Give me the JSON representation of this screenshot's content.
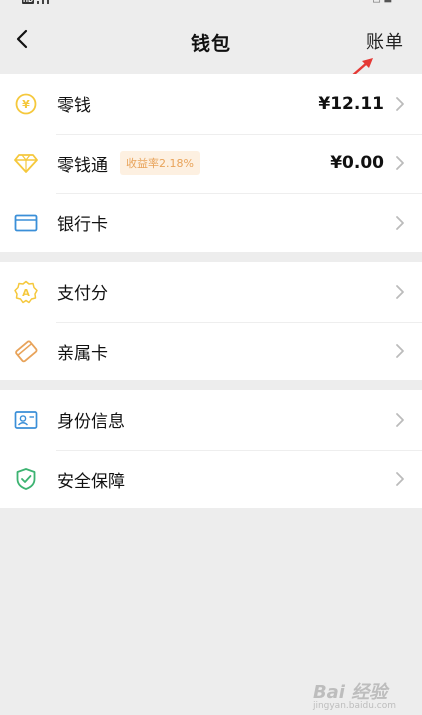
{
  "header": {
    "title": "钱包",
    "bill_label": "账单"
  },
  "groups": [
    {
      "items": [
        {
          "label": "零钱",
          "value": "¥12.11"
        },
        {
          "label": "零钱通",
          "badge": "收益率2.18%",
          "value": "¥0.00"
        },
        {
          "label": "银行卡"
        }
      ]
    },
    {
      "items": [
        {
          "label": "支付分"
        },
        {
          "label": "亲属卡"
        }
      ]
    },
    {
      "items": [
        {
          "label": "身份信息"
        },
        {
          "label": "安全保障"
        }
      ]
    }
  ],
  "icons": {
    "coin": "yuan-coin-icon",
    "diamond": "diamond-icon",
    "bank_card": "bank-card-icon",
    "score": "badge-icon",
    "family_card": "family-card-icon",
    "id_info": "id-card-icon",
    "security": "shield-icon"
  },
  "colors": {
    "yellow": "#f5c83c",
    "orange": "#e8a35a",
    "blue": "#3a8fd8",
    "green": "#3cb371",
    "red_arrow": "#e53935"
  },
  "watermark": {
    "brand": "Bai 经验",
    "sub": "jingyan.baidu.com"
  }
}
